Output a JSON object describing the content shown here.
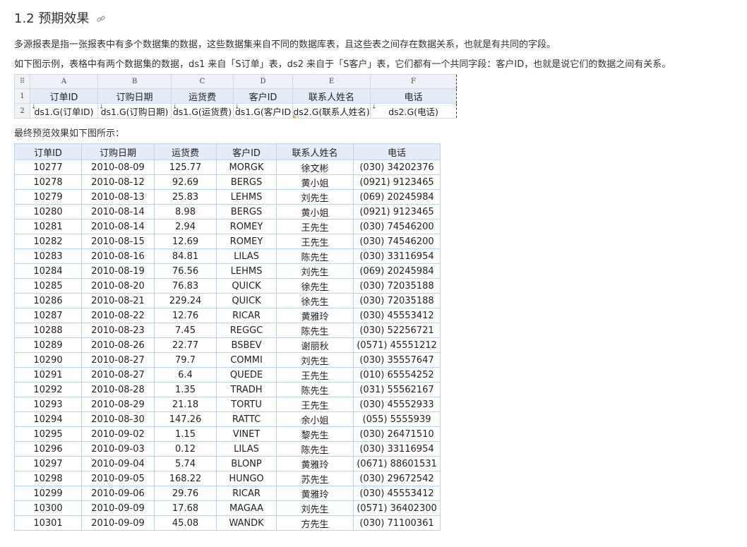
{
  "section": {
    "title": "1.2 预期效果",
    "para1": "多源报表是指一张报表中有多个数据集的数据，这些数据集来自不同的数据库表，且这些表之间存在数据关系，也就是有共同的字段。",
    "para2": "如下图示例，表格中有两个数据集的数据，ds1 来自「S订单」表，ds2 来自于「S客户」表，它们都有一个共同字段：客户ID，也就是说它们的数据之间有关系。",
    "para3": "最终预览效果如下图所示："
  },
  "designer": {
    "corner": "⠿",
    "columns": [
      "A",
      "B",
      "C",
      "D",
      "E",
      "F"
    ],
    "row_numbers": [
      "1",
      "2"
    ],
    "row1": [
      "订单ID",
      "订购日期",
      "运货费",
      "客户ID",
      "联系人姓名",
      "电话"
    ],
    "row2": [
      "ds1.G(订单ID)",
      "ds1.G(订购日期)",
      "ds1.G(运货费)",
      "ds1.G(客户ID",
      "ds2.G(联系人姓名)",
      "ds2.G(电话)"
    ],
    "expand_mark": "↓"
  },
  "result": {
    "headers": [
      "订单ID",
      "订购日期",
      "运货费",
      "客户ID",
      "联系人姓名",
      "电话"
    ],
    "rows": [
      [
        "10277",
        "2010-08-09",
        "125.77",
        "MORGK",
        "徐文彬",
        "(030) 34202376"
      ],
      [
        "10278",
        "2010-08-12",
        "92.69",
        "BERGS",
        "黄小姐",
        "(0921) 9123465"
      ],
      [
        "10279",
        "2010-08-13",
        "25.83",
        "LEHMS",
        "刘先生",
        "(069) 20245984"
      ],
      [
        "10280",
        "2010-08-14",
        "8.98",
        "BERGS",
        "黄小姐",
        "(0921) 9123465"
      ],
      [
        "10281",
        "2010-08-14",
        "2.94",
        "ROMEY",
        "王先生",
        "(030) 74546200"
      ],
      [
        "10282",
        "2010-08-15",
        "12.69",
        "ROMEY",
        "王先生",
        "(030) 74546200"
      ],
      [
        "10283",
        "2010-08-16",
        "84.81",
        "LILAS",
        "陈先生",
        "(030) 33116954"
      ],
      [
        "10284",
        "2010-08-19",
        "76.56",
        "LEHMS",
        "刘先生",
        "(069) 20245984"
      ],
      [
        "10285",
        "2010-08-20",
        "76.83",
        "QUICK",
        "徐先生",
        "(030) 72035188"
      ],
      [
        "10286",
        "2010-08-21",
        "229.24",
        "QUICK",
        "徐先生",
        "(030) 72035188"
      ],
      [
        "10287",
        "2010-08-22",
        "12.76",
        "RICAR",
        "黄雅玲",
        "(030) 45553412"
      ],
      [
        "10288",
        "2010-08-23",
        "7.45",
        "REGGC",
        "陈先生",
        "(030) 52256721"
      ],
      [
        "10289",
        "2010-08-26",
        "22.77",
        "BSBEV",
        "谢丽秋",
        "(0571) 45551212"
      ],
      [
        "10290",
        "2010-08-27",
        "79.7",
        "COMMI",
        "刘先生",
        "(030) 35557647"
      ],
      [
        "10291",
        "2010-08-27",
        "6.4",
        "QUEDE",
        "王先生",
        "(010) 65554252"
      ],
      [
        "10292",
        "2010-08-28",
        "1.35",
        "TRADH",
        "陈先生",
        "(031) 55562167"
      ],
      [
        "10293",
        "2010-08-29",
        "21.18",
        "TORTU",
        "王先生",
        "(030) 45552933"
      ],
      [
        "10294",
        "2010-08-30",
        "147.26",
        "RATTC",
        "余小姐",
        "(055) 5555939"
      ],
      [
        "10295",
        "2010-09-02",
        "1.15",
        "VINET",
        "黎先生",
        "(030) 26471510"
      ],
      [
        "10296",
        "2010-09-03",
        "0.12",
        "LILAS",
        "陈先生",
        "(030) 33116954"
      ],
      [
        "10297",
        "2010-09-04",
        "5.74",
        "BLONP",
        "黄雅玲",
        "(0671) 88601531"
      ],
      [
        "10298",
        "2010-09-05",
        "168.22",
        "HUNGO",
        "苏先生",
        "(030) 29672542"
      ],
      [
        "10299",
        "2010-09-06",
        "29.76",
        "RICAR",
        "黄雅玲",
        "(030) 45553412"
      ],
      [
        "10300",
        "2010-09-09",
        "17.68",
        "MAGAA",
        "刘先生",
        "(0571) 36402300"
      ],
      [
        "10301",
        "2010-09-09",
        "45.08",
        "WANDK",
        "方先生",
        "(030) 71100361"
      ]
    ]
  }
}
